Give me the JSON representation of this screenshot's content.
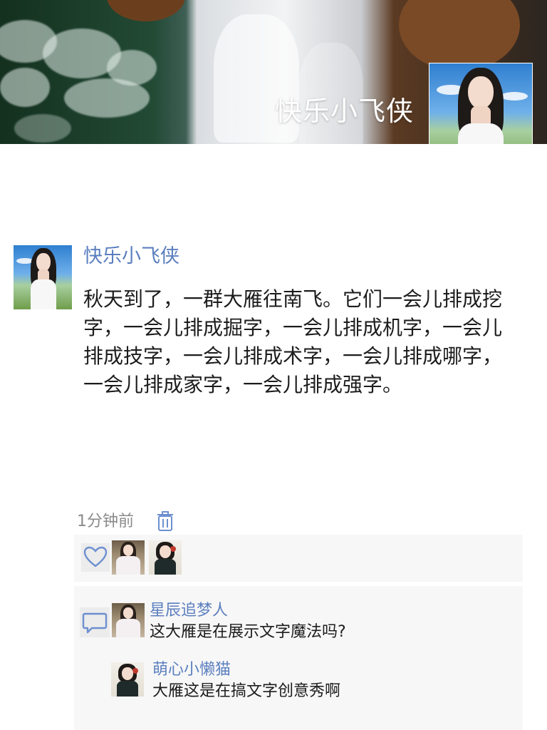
{
  "cover": {
    "name": "快乐小飞侠"
  },
  "post": {
    "author": "快乐小飞侠",
    "text": "秋天到了，一群大雁往南飞。它们一会儿排成挖字，一会儿排成掘字，一会儿排成机字，一会儿排成技字，一会儿排成术字，一会儿排成哪字，一会儿排成家字，一会儿排成强字。",
    "time": "1分钟前"
  },
  "likes": {
    "icon": "heart-icon"
  },
  "comments": [
    {
      "author": "星辰追梦人",
      "text": "这大雁是在展示文字魔法吗?"
    },
    {
      "author": "萌心小懒猫",
      "text": "大雁这是在搞文字创意秀啊"
    }
  ],
  "colors": {
    "link": "#5b7fbf",
    "text": "#1c1c1c",
    "muted": "#8a8a8a",
    "panel": "#f7f7f7"
  }
}
